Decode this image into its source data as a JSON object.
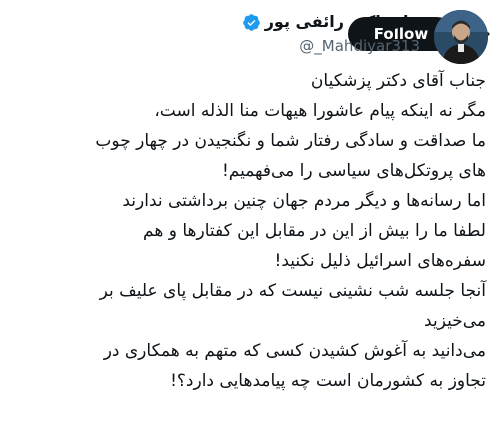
{
  "tweet": {
    "author": {
      "display_name": "علی اکبر رائفی پور",
      "handle": "@_Mahdiyar313",
      "verified": true
    },
    "follow_label": "Follow",
    "lines": [
      "جناب آقای دکتر پزشکیان",
      "مگر نه اینکه پیام عاشورا هیهات منا الذله است،",
      "ما صداقت و سادگی رفتار شما و نگنجیدن در چهار چوب",
      "های پروتکل‌های سیاسی را می‌فهمیم!",
      "اما رسانه‌ها و دیگر مردم جهان چنین برداشتی ندارند",
      "لطفا ما را بیش از این در مقابل این کفتارها و هم",
      "سفره‌های اسرائیل ذلیل نکنید!",
      "آنجا جلسه شب نشینی نیست که در مقابل پای علیف بر",
      "می‌خیزید",
      "می‌دانید به آغوش کشیدن کسی که متهم به همکاری در",
      "تجاوز به کشورمان است چه پیامدهایی دارد؟!"
    ]
  },
  "colors": {
    "text": "#0f1419",
    "secondary": "#536471",
    "verified": "#1d9bf0",
    "follow_bg": "#0f1419",
    "follow_text": "#ffffff"
  },
  "icons": {
    "verified": "verified-badge-icon",
    "more": "more-dots-icon"
  }
}
